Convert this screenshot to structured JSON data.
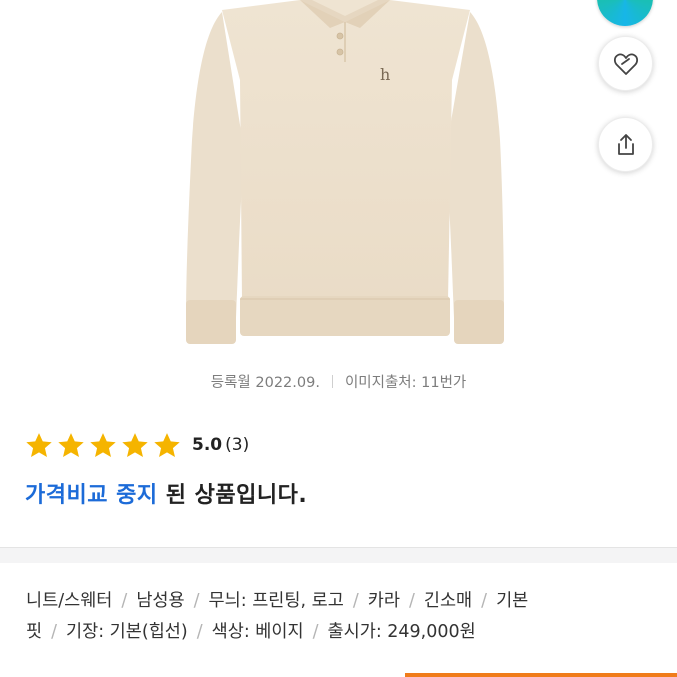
{
  "product_image": {
    "alt": "Beige knit polo collar sweater",
    "logo_mark": "h"
  },
  "actions": [
    {
      "name": "wishlist",
      "icon": "heart-icon"
    },
    {
      "name": "share",
      "icon": "share-icon"
    }
  ],
  "meta": {
    "registered": "등록월 2022.09.",
    "image_source": "이미지출처: 11번가"
  },
  "rating": {
    "stars": 5,
    "score": "5.0",
    "count": "(3)",
    "star_color": "#f5b400"
  },
  "status": {
    "highlight": "가격비교 중지",
    "rest": " 된 상품입니다.",
    "highlight_color": "#1c6bd8"
  },
  "specs": {
    "line1": [
      "니트/스웨터",
      "남성용",
      "무늬: 프린팅, 로고",
      "카라",
      "긴소매",
      "기본"
    ],
    "line2_lead": "핏",
    "line2": [
      "기장: 기본(힙선)",
      "색상: 베이지",
      "출시가: 249,000원"
    ],
    "separator": "/"
  }
}
